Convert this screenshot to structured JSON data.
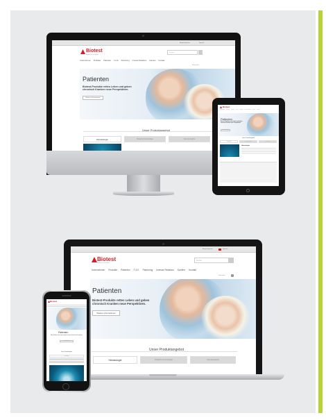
{
  "site": {
    "brand": "Biotest",
    "brand_sub": "Biotest Deutschland",
    "search_placeholder": "Suchen",
    "topbar_links": [
      "Ansprechpartner",
      "Sprache"
    ],
    "nav": [
      "Unternehmen",
      "Produkte",
      "Patienten",
      "F & E",
      "Partnering",
      "Investor Relations",
      "Karriere",
      "Kontakt"
    ],
    "share_label": "Seite teilen",
    "hero": {
      "title": "Patienten",
      "text": "Biotest-Produkte retten Leben und geben chronisch Kranken neue Perspektiven.",
      "button": "Weitere Informationen"
    },
    "products_title": "Unser Produktangebot",
    "tabs": [
      "Hämatologie",
      "Klinische Immunologie",
      "Intensivmedizin"
    ]
  },
  "colors": {
    "panel": "#e9eaec",
    "accent_bar": "#b5d334",
    "brand_red": "#cf1f2d"
  },
  "icons": [
    "camera-icon",
    "home-button-icon",
    "search-icon",
    "flag-icon",
    "share-icon"
  ]
}
